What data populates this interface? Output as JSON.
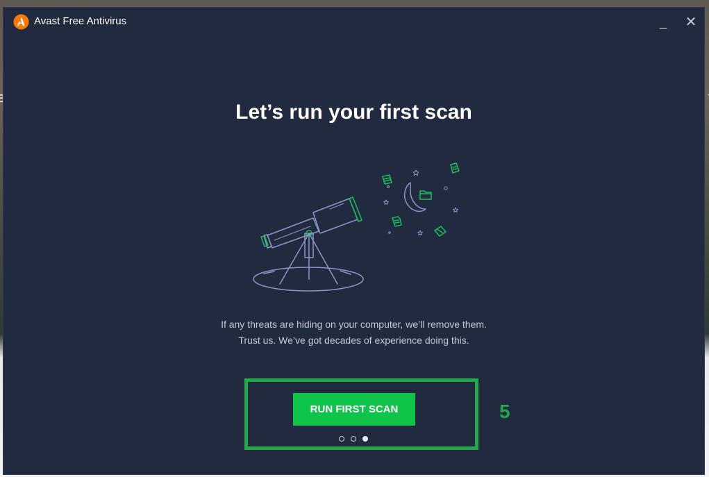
{
  "window": {
    "title": "Avast Free Antivirus",
    "minimize_glyph": "_",
    "close_glyph": "✕"
  },
  "page": {
    "heading": "Let’s run your first scan",
    "description_line1": "If any threats are hiding on your computer, we’ll remove them.",
    "description_line2": "Trust us. We’ve got decades of experience doing this.",
    "cta_label": "RUN FIRST SCAN",
    "pager": {
      "total": 3,
      "current": 3
    }
  },
  "annotation": {
    "step_number": "5"
  },
  "background_edges": {
    "left_char": "e",
    "right_char": "t"
  },
  "colors": {
    "window_bg": "#222a40",
    "accent_green": "#0fc549",
    "annotation_green": "#22a94a",
    "logo_orange": "#ff7800",
    "illustration_line": "#8e96c8"
  },
  "icons": [
    "avast-logo-icon",
    "minimize-icon",
    "close-icon",
    "telescope-illustration"
  ]
}
